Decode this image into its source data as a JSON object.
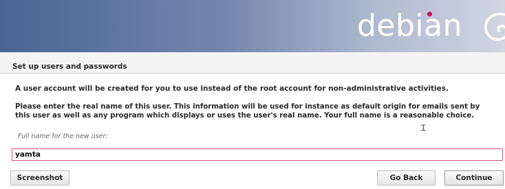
{
  "banner": {
    "logo_text": "debian"
  },
  "header": {
    "title": "Set up users and passwords"
  },
  "body": {
    "paragraph1": "A user account will be created for you to use instead of the root account for non-administrative activities.",
    "paragraph2": "Please enter the real name of this user. This information will be used for instance as default origin for emails sent by this user as well as any program which displays or uses the user's real name. Your full name is a reasonable choice."
  },
  "form": {
    "field_label": "Full name for the new user:",
    "field_value": "yamta"
  },
  "buttons": {
    "screenshot_label": "Screenshot",
    "go_back_label": "Go Back",
    "continue_label": "Continue"
  },
  "colors": {
    "focus_border": "#d0507a",
    "debian_red": "#d70751"
  }
}
